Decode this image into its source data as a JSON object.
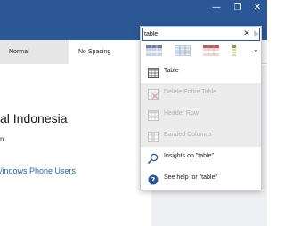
{
  "window": {
    "minimize_glyph": "—",
    "maximize_glyph": "❐",
    "close_glyph": "✕"
  },
  "styles": {
    "normal_label": "Normal",
    "no_spacing_label": "No Spacing"
  },
  "document": {
    "title_fragment": "al Indonesia",
    "line_fragment": "n",
    "link_fragment": "/indows Phone Users"
  },
  "search": {
    "value": "table",
    "clear_glyph": "✕"
  },
  "gallery": {
    "items": [
      "table-style-1",
      "table-style-2",
      "table-style-3",
      "table-style-4"
    ],
    "more_glyph": "⌄"
  },
  "menu": {
    "items": [
      {
        "label": "Table",
        "icon": "table-icon",
        "enabled": true
      },
      {
        "label": "Delete Entire Table",
        "icon": "delete-table-icon",
        "enabled": false
      },
      {
        "label": "Header Row",
        "icon": "header-row-icon",
        "enabled": false
      },
      {
        "label": "Banded Columns",
        "icon": "banded-columns-icon",
        "enabled": false
      },
      {
        "label": "Insights on \"table\"",
        "icon": "insights-icon",
        "enabled": true
      },
      {
        "label": "See help for \"table\"",
        "icon": "help-icon",
        "enabled": true
      }
    ]
  },
  "colors": {
    "accent": "#2b5797",
    "link": "#2466b8"
  }
}
